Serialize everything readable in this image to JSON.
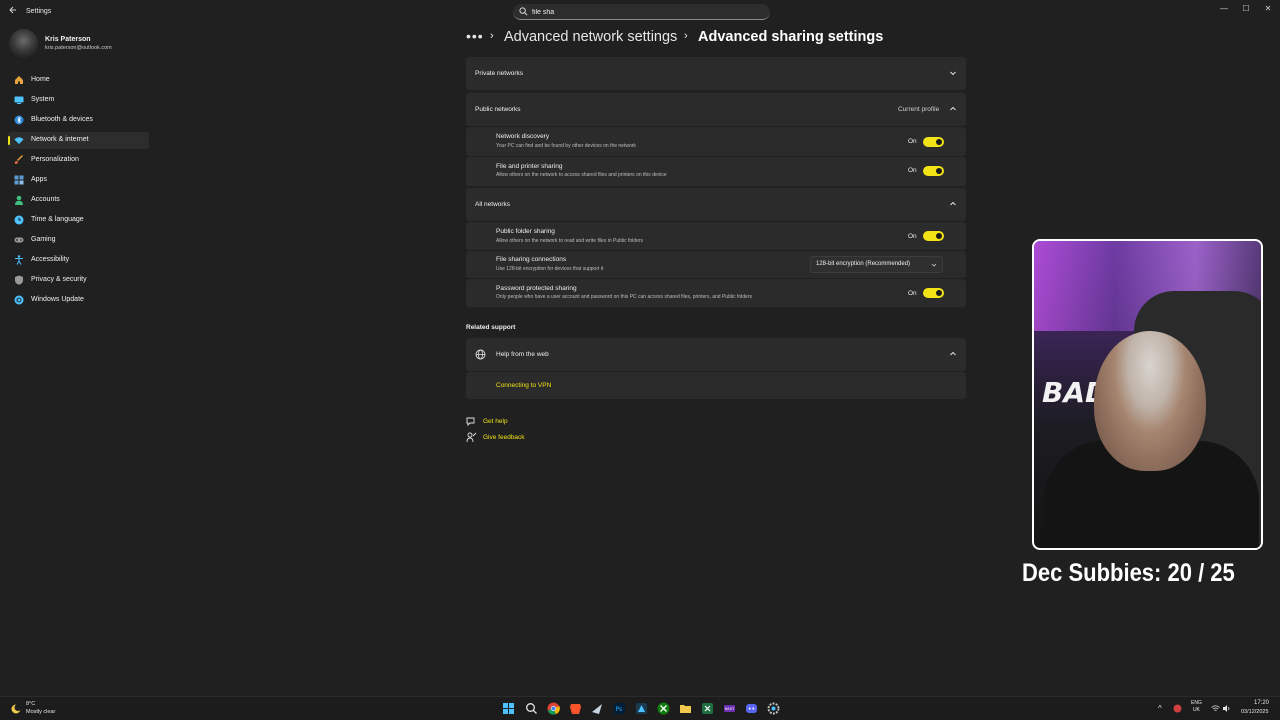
{
  "window": {
    "title": "Settings",
    "search_value": "file sha",
    "controls": {
      "minimize": "—",
      "maximize": "☐",
      "close": "✕"
    }
  },
  "profile": {
    "name": "Kris Paterson",
    "email": "kris.paterson@outlook.com"
  },
  "sidebar": {
    "items": [
      {
        "label": "Home",
        "icon": "home-icon",
        "color": "#e8a33d"
      },
      {
        "label": "System",
        "icon": "monitor-icon",
        "color": "#4cc2ff"
      },
      {
        "label": "Bluetooth & devices",
        "icon": "bluetooth-icon",
        "color": "#2b88d8"
      },
      {
        "label": "Network & internet",
        "icon": "wifi-icon",
        "color": "#4cc2ff",
        "active": true
      },
      {
        "label": "Personalization",
        "icon": "brush-icon",
        "color": "#e8a33d"
      },
      {
        "label": "Apps",
        "icon": "apps-icon",
        "color": "#5b9bd5"
      },
      {
        "label": "Accounts",
        "icon": "person-icon",
        "color": "#3fbf7f"
      },
      {
        "label": "Time & language",
        "icon": "globe-clock-icon",
        "color": "#4cc2ff"
      },
      {
        "label": "Gaming",
        "icon": "gamepad-icon",
        "color": "#8a8a8a"
      },
      {
        "label": "Accessibility",
        "icon": "accessibility-icon",
        "color": "#4cc2ff"
      },
      {
        "label": "Privacy & security",
        "icon": "shield-icon",
        "color": "#8a8a8a"
      },
      {
        "label": "Windows Update",
        "icon": "update-icon",
        "color": "#4cc2ff"
      }
    ]
  },
  "breadcrumb": {
    "more": "•••",
    "sep": "›",
    "parent": "Advanced network settings",
    "current": "Advanced sharing settings"
  },
  "sections": {
    "private": {
      "title": "Private networks"
    },
    "public": {
      "title": "Public networks",
      "tag": "Current profile",
      "rows": [
        {
          "title": "Network discovery",
          "desc": "Your PC can find and be found by other devices on the network",
          "state": "On"
        },
        {
          "title": "File and printer sharing",
          "desc": "Allow others on the network to access shared files and printers on this device",
          "state": "On"
        }
      ]
    },
    "all": {
      "title": "All networks",
      "rows": [
        {
          "title": "Public folder sharing",
          "desc": "Allow others on the network to read and write files in Public folders",
          "state": "On"
        },
        {
          "title": "File sharing connections",
          "desc": "Use 128-bit encryption for devices that support it",
          "dropdown": "128-bit encryption (Recommended)"
        },
        {
          "title": "Password protected sharing",
          "desc": "Only people who have a user account and password on this PC can access shared files, printers, and Public folders",
          "state": "On"
        }
      ]
    }
  },
  "related": {
    "label": "Related support",
    "help_title": "Help from the web",
    "link": "Connecting to VPN"
  },
  "footer_links": {
    "get_help": "Get help",
    "feedback": "Give feedback"
  },
  "overlay": {
    "logo_text": "BAD",
    "subbies": "Dec Subbies:  20 / 25"
  },
  "taskbar": {
    "weather_temp": "8°C",
    "weather_desc": "Mostly clear",
    "lang_top": "ENG",
    "lang_bottom": "UK",
    "time": "17:20",
    "date": "03/12/2025",
    "tray_chevron": "^",
    "apps": [
      "start-icon",
      "search-icon",
      "chrome-icon",
      "brave-icon",
      "steam-icon",
      "photoshop-icon",
      "affinity-icon",
      "xbox-icon",
      "file-explorer-icon",
      "excel-icon",
      "next-icon",
      "discord-icon",
      "settings-icon"
    ]
  },
  "colors": {
    "accent": "#f1e316",
    "background": "#202020",
    "card": "#2b2b2b"
  }
}
